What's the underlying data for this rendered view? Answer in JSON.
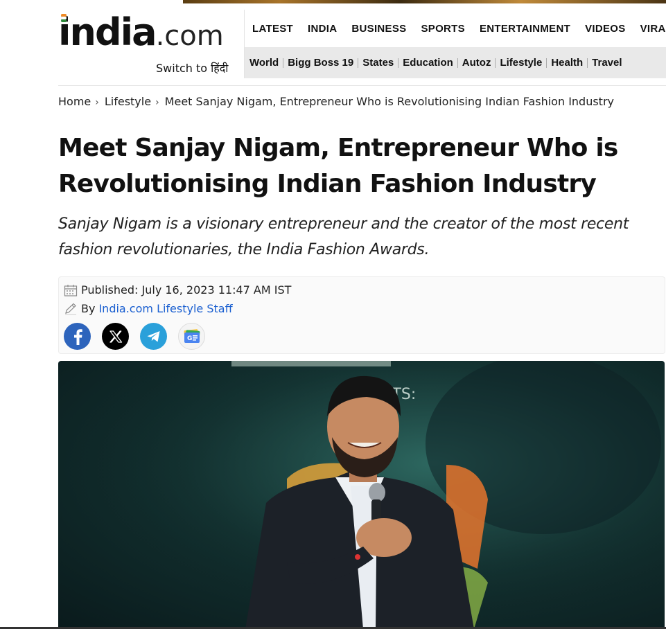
{
  "logo": {
    "word": "india",
    "suffix": ".com",
    "switch_label": "Switch to हिंदी"
  },
  "main_nav": [
    "LATEST",
    "INDIA",
    "BUSINESS",
    "SPORTS",
    "ENTERTAINMENT",
    "VIDEOS",
    "VIRA"
  ],
  "sub_nav": [
    "World",
    "Bigg Boss 19",
    "States",
    "Education",
    "Autoz",
    "Lifestyle",
    "Health",
    "Travel"
  ],
  "breadcrumb": {
    "home": "Home",
    "section": "Lifestyle",
    "current": "Meet Sanjay Nigam, Entrepreneur Who is Revolutionising Indian Fashion Industry"
  },
  "article": {
    "title": "Meet Sanjay Nigam, Entrepreneur Who is Revolutionising Indian Fashion Industry",
    "summary": "Sanjay Nigam is a visionary entrepreneur and the creator of the most recent fashion revolutionaries, the India Fashion Awards.",
    "published": "Published: July 16, 2023 11:47 AM IST",
    "by_label": "By",
    "author": "India.com Lifestyle Staff"
  },
  "share_icons": [
    "facebook-icon",
    "x-icon",
    "telegram-icon",
    "google-news-icon"
  ],
  "hero": {
    "backdrop_text": "NTS:"
  },
  "colors": {
    "author_link": "#1a5fd0",
    "facebook": "#2d64bc",
    "telegram": "#2aa0da",
    "subnav_bg": "#e9e9e9"
  }
}
